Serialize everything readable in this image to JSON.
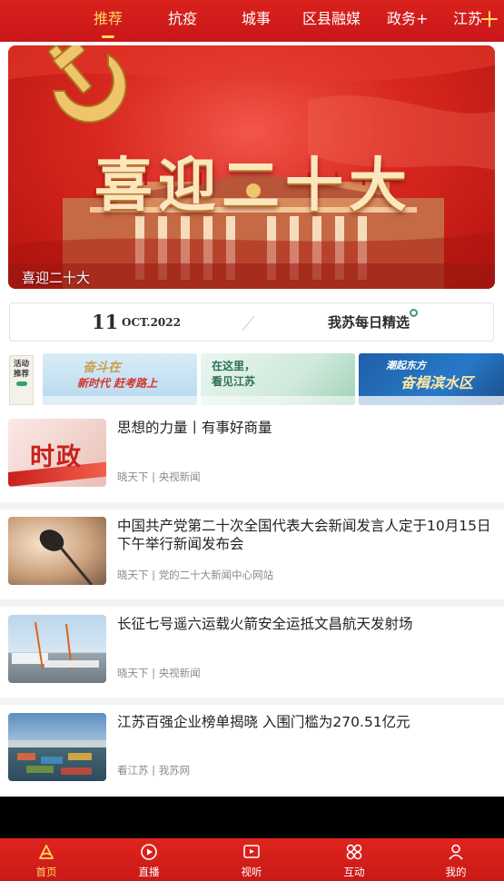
{
  "top_tabs": [
    {
      "label": "推荐",
      "active": true
    },
    {
      "label": "抗疫",
      "active": false
    },
    {
      "label": "城事",
      "active": false
    },
    {
      "label": "区县融媒",
      "active": false
    },
    {
      "label": "政务+",
      "active": false
    },
    {
      "label": "江苏",
      "active": false
    }
  ],
  "top_icons": {
    "add": "plus-icon"
  },
  "banner": {
    "headline": "喜迎二十大",
    "caption": "喜迎二十大"
  },
  "date_strip": {
    "day": "11",
    "month_year": "OCT.2022",
    "daily_pick": "我苏每日精选"
  },
  "activity": {
    "label": "活动推荐",
    "cards": [
      {
        "line1": "奋斗在",
        "line2": "新时代 赶考路上"
      },
      {
        "line1": "在这里，",
        "line2": "看见江苏"
      },
      {
        "line1": "潮起东方",
        "line2": "奋楫滨水区"
      }
    ]
  },
  "news": [
    {
      "title": "思想的力量丨有事好商量",
      "channel": "晓天下",
      "source": "央视新闻",
      "thumb_text": "时政"
    },
    {
      "title": "中国共产党第二十次全国代表大会新闻发言人定于10月15日下午举行新闻发布会",
      "channel": "晓天下",
      "source": "党的二十大新闻中心网站",
      "thumb_text": ""
    },
    {
      "title": "长征七号遥六运载火箭安全运抵文昌航天发射场",
      "channel": "晓天下",
      "source": "央视新闻",
      "thumb_text": ""
    },
    {
      "title": "江苏百强企业榜单揭晓 入围门槛为270.51亿元",
      "channel": "看江苏",
      "source": "我苏网",
      "thumb_text": ""
    }
  ],
  "bottom_nav": [
    {
      "label": "首页",
      "icon": "home-icon",
      "active": true
    },
    {
      "label": "直播",
      "icon": "play-icon",
      "active": false
    },
    {
      "label": "视听",
      "icon": "video-icon",
      "active": false
    },
    {
      "label": "互动",
      "icon": "grid-icon",
      "active": false
    },
    {
      "label": "我的",
      "icon": "profile-icon",
      "active": false
    }
  ],
  "colors": {
    "brand_red": "#d9221c",
    "active_tab": "#ffd75e",
    "meta_gray": "#8a8a8a"
  }
}
